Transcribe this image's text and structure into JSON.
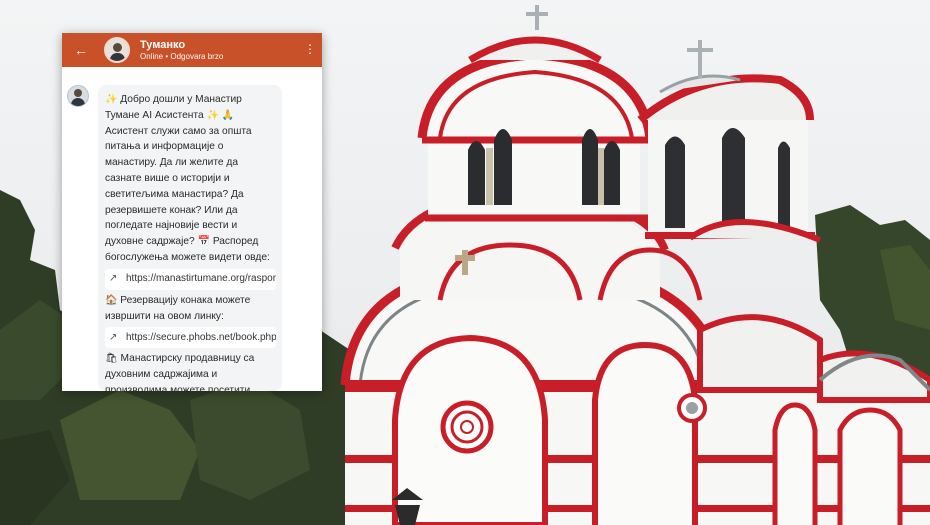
{
  "chat": {
    "title": "Туманко",
    "status": "Online • Odgovara brzo",
    "back_icon": "arrow-left-icon",
    "menu_icon": "more-vertical-icon",
    "accent_color": "#c9512a",
    "message": {
      "intro": "Добро дошли у Манастир Тумане AI Асистента",
      "line2": "Асистент служи само за општа питања и информације о манастиру.  Да ли желите да сазнате више о историји и светитељима манастира? Да резервишете конак? Или да погледате најновије вести и духовне садржаје?",
      "schedule": "Распоред богослужења можете видети овде:",
      "link1": "https://manastirtumane.org/raspored",
      "lodging": "Резервацију конака можете извршити на овом линку:",
      "link2": "https://secure.phobs.net/book.php",
      "shop": "Манастирску продавницу са духовним садржајима и производима можете посетити"
    },
    "icons": {
      "sparkle": "✨",
      "pray": "🙏",
      "calendar": "📅",
      "house": "🏠",
      "shop": "🛍",
      "external": "↗"
    }
  }
}
